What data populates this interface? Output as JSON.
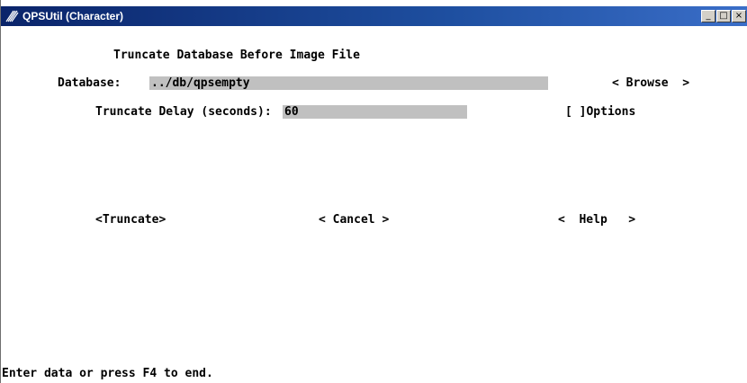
{
  "window": {
    "title": "QPSUtil (Character)",
    "icon": "app-icon",
    "controls": {
      "minimize": "_",
      "maximize": "□",
      "close": "×"
    }
  },
  "form": {
    "heading": "Truncate Database Before Image File",
    "database_label": "Database:",
    "database_value": "../db/qpsempty",
    "browse_button": "< Browse  >",
    "delay_label": "Truncate Delay (seconds):",
    "delay_value": "60",
    "options_checkbox": "[ ]Options",
    "truncate_button": "<Truncate>",
    "cancel_button": "< Cancel >",
    "help_button": "<  Help   >"
  },
  "status_bar": {
    "message": "Enter data or press F4 to end."
  },
  "colors": {
    "title_bar": "#0a246a",
    "field_bg": "#c0c0c0",
    "text": "#000000"
  }
}
